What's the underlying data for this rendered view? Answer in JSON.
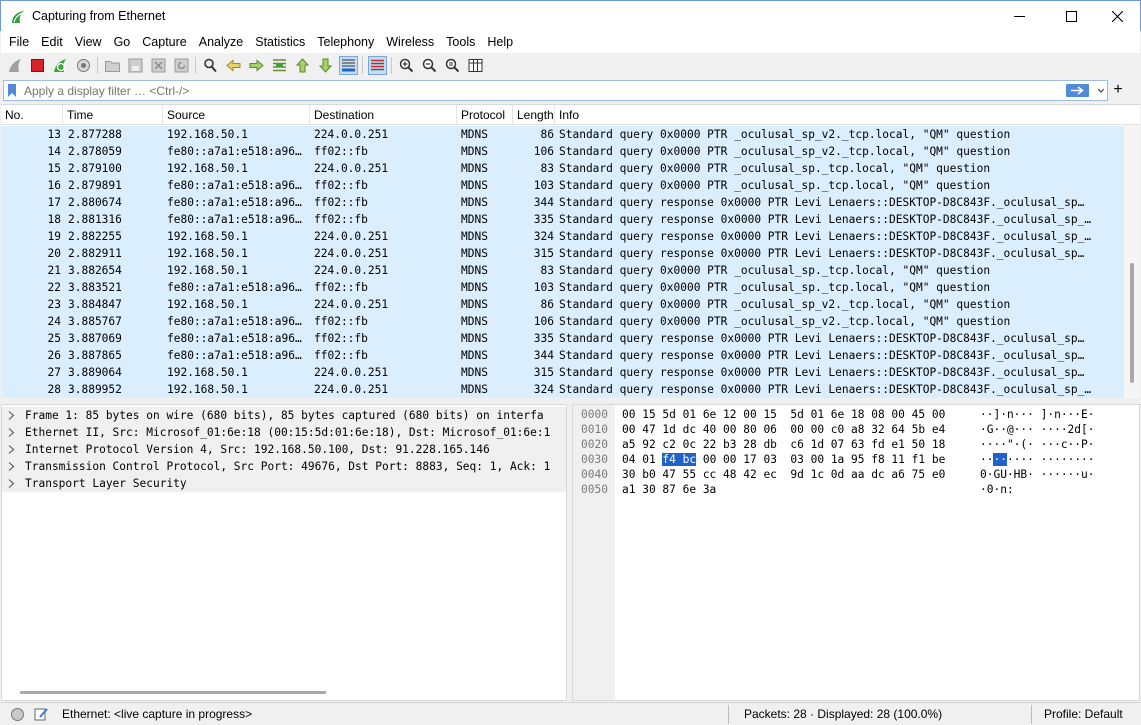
{
  "window": {
    "title": "Capturing from Ethernet",
    "accent": "#1f7a1f"
  },
  "menu": [
    "File",
    "Edit",
    "View",
    "Go",
    "Capture",
    "Analyze",
    "Statistics",
    "Telephony",
    "Wireless",
    "Tools",
    "Help"
  ],
  "toolbar": {
    "icons": [
      "shark-fin-start-icon",
      "stop-capture-icon",
      "restart-capture-icon",
      "capture-options-icon",
      "open-file-icon",
      "save-file-icon",
      "close-file-icon",
      "reload-file-icon",
      "find-packet-icon",
      "go-back-icon",
      "go-forward-icon",
      "go-to-packet-icon",
      "go-first-icon",
      "go-last-icon",
      "autoscroll-icon",
      "colorize-icon",
      "zoom-in-icon",
      "zoom-out-icon",
      "zoom-reset-icon",
      "resize-columns-icon"
    ]
  },
  "filter": {
    "placeholder": "Apply a display filter … <Ctrl-/>",
    "plus": "+"
  },
  "columns": [
    "No.",
    "Time",
    "Source",
    "Destination",
    "Protocol",
    "Length",
    "Info"
  ],
  "packets": [
    {
      "no": "13",
      "time": "2.877288",
      "src": "192.168.50.1",
      "dst": "224.0.0.251",
      "proto": "MDNS",
      "len": "86",
      "info": "Standard query 0x0000 PTR _oculusal_sp_v2._tcp.local, \"QM\" question"
    },
    {
      "no": "14",
      "time": "2.878059",
      "src": "fe80::a7a1:e518:a96…",
      "dst": "ff02::fb",
      "proto": "MDNS",
      "len": "106",
      "info": "Standard query 0x0000 PTR _oculusal_sp_v2._tcp.local, \"QM\" question"
    },
    {
      "no": "15",
      "time": "2.879100",
      "src": "192.168.50.1",
      "dst": "224.0.0.251",
      "proto": "MDNS",
      "len": "83",
      "info": "Standard query 0x0000 PTR _oculusal_sp._tcp.local, \"QM\" question"
    },
    {
      "no": "16",
      "time": "2.879891",
      "src": "fe80::a7a1:e518:a96…",
      "dst": "ff02::fb",
      "proto": "MDNS",
      "len": "103",
      "info": "Standard query 0x0000 PTR _oculusal_sp._tcp.local, \"QM\" question"
    },
    {
      "no": "17",
      "time": "2.880674",
      "src": "fe80::a7a1:e518:a96…",
      "dst": "ff02::fb",
      "proto": "MDNS",
      "len": "344",
      "info": "Standard query response 0x0000 PTR Levi Lenaers::DESKTOP-D8C843F._oculusal_sp…"
    },
    {
      "no": "18",
      "time": "2.881316",
      "src": "fe80::a7a1:e518:a96…",
      "dst": "ff02::fb",
      "proto": "MDNS",
      "len": "335",
      "info": "Standard query response 0x0000 PTR Levi Lenaers::DESKTOP-D8C843F._oculusal_sp_…"
    },
    {
      "no": "19",
      "time": "2.882255",
      "src": "192.168.50.1",
      "dst": "224.0.0.251",
      "proto": "MDNS",
      "len": "324",
      "info": "Standard query response 0x0000 PTR Levi Lenaers::DESKTOP-D8C843F._oculusal_sp_…"
    },
    {
      "no": "20",
      "time": "2.882911",
      "src": "192.168.50.1",
      "dst": "224.0.0.251",
      "proto": "MDNS",
      "len": "315",
      "info": "Standard query response 0x0000 PTR Levi Lenaers::DESKTOP-D8C843F._oculusal_sp…"
    },
    {
      "no": "21",
      "time": "3.882654",
      "src": "192.168.50.1",
      "dst": "224.0.0.251",
      "proto": "MDNS",
      "len": "83",
      "info": "Standard query 0x0000 PTR _oculusal_sp._tcp.local, \"QM\" question"
    },
    {
      "no": "22",
      "time": "3.883521",
      "src": "fe80::a7a1:e518:a96…",
      "dst": "ff02::fb",
      "proto": "MDNS",
      "len": "103",
      "info": "Standard query 0x0000 PTR _oculusal_sp._tcp.local, \"QM\" question"
    },
    {
      "no": "23",
      "time": "3.884847",
      "src": "192.168.50.1",
      "dst": "224.0.0.251",
      "proto": "MDNS",
      "len": "86",
      "info": "Standard query 0x0000 PTR _oculusal_sp_v2._tcp.local, \"QM\" question"
    },
    {
      "no": "24",
      "time": "3.885767",
      "src": "fe80::a7a1:e518:a96…",
      "dst": "ff02::fb",
      "proto": "MDNS",
      "len": "106",
      "info": "Standard query 0x0000 PTR _oculusal_sp_v2._tcp.local, \"QM\" question"
    },
    {
      "no": "25",
      "time": "3.887069",
      "src": "fe80::a7a1:e518:a96…",
      "dst": "ff02::fb",
      "proto": "MDNS",
      "len": "335",
      "info": "Standard query response 0x0000 PTR Levi Lenaers::DESKTOP-D8C843F._oculusal_sp…"
    },
    {
      "no": "26",
      "time": "3.887865",
      "src": "fe80::a7a1:e518:a96…",
      "dst": "ff02::fb",
      "proto": "MDNS",
      "len": "344",
      "info": "Standard query response 0x0000 PTR Levi Lenaers::DESKTOP-D8C843F._oculusal_sp…"
    },
    {
      "no": "27",
      "time": "3.889064",
      "src": "192.168.50.1",
      "dst": "224.0.0.251",
      "proto": "MDNS",
      "len": "315",
      "info": "Standard query response 0x0000 PTR Levi Lenaers::DESKTOP-D8C843F._oculusal_sp…"
    },
    {
      "no": "28",
      "time": "3.889952",
      "src": "192.168.50.1",
      "dst": "224.0.0.251",
      "proto": "MDNS",
      "len": "324",
      "info": "Standard query response 0x0000 PTR Levi Lenaers::DESKTOP-D8C843F._oculusal_sp_…"
    }
  ],
  "row_color": "#dbeefd",
  "details": [
    "Frame 1: 85 bytes on wire (680 bits), 85 bytes captured (680 bits) on interfa",
    "Ethernet II, Src: Microsof_01:6e:18 (00:15:5d:01:6e:18), Dst: Microsof_01:6e:1",
    "Internet Protocol Version 4, Src: 192.168.50.100, Dst: 91.228.165.146",
    "Transmission Control Protocol, Src Port: 49676, Dst Port: 8883, Seq: 1, Ack: 1",
    "Transport Layer Security"
  ],
  "bytes": [
    {
      "off": "0000",
      "hex": "00 15 5d 01 6e 12 00 15  5d 01 6e 18 08 00 45 00",
      "ascii": "··]·n··· ]·n···E·"
    },
    {
      "off": "0010",
      "hex": "00 47 1d dc 40 00 80 06  00 00 c0 a8 32 64 5b e4",
      "ascii": "·G··@··· ····2d[·"
    },
    {
      "off": "0020",
      "hex": "a5 92 c2 0c 22 b3 28 db  c6 1d 07 63 fd e1 50 18",
      "ascii": "····\"·(· ···c··P·"
    },
    {
      "off": "0030",
      "hex_pre": "04 01 ",
      "hex_hl": "f4 bc",
      "hex_post": " 00 00 17 03  03 00 1a 95 f8 11 f1 be",
      "ascii_pre": "··",
      "ascii_hl": "··",
      "ascii_post": "···· ········"
    },
    {
      "off": "0040",
      "hex": "30 b0 47 55 cc 48 42 ec  9d 1c 0d aa dc a6 75 e0",
      "ascii": "0·GU·HB· ······u·"
    },
    {
      "off": "0050",
      "hex": "a1 30 87 6e 3a",
      "ascii": "·0·n:"
    }
  ],
  "status": {
    "capture": "Ethernet: <live capture in progress>",
    "packets": "Packets: 28 · Displayed: 28 (100.0%)",
    "profile": "Profile: Default"
  }
}
